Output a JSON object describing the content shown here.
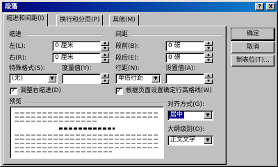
{
  "window": {
    "title": "段落"
  },
  "title_buttons": {
    "help": "?",
    "close": "X"
  },
  "tabs": [
    {
      "label": "缩进和间距(I)"
    },
    {
      "label": "换行和分页(P)"
    },
    {
      "label": "其他(M)"
    }
  ],
  "indent": {
    "section": "缩进",
    "left_label": "左(L):",
    "left_value": "0 厘米",
    "right_label": "右(R):",
    "right_value": "0 厘米",
    "special_label": "特殊格式(S):",
    "special_value": "(无)",
    "measure_label": "度量值(Y):",
    "measure_value": "",
    "mirror_check": "调整右缩进(D)",
    "mirror_checked": true
  },
  "spacing": {
    "section": "间距",
    "before_label": "段前(B):",
    "before_value": "0 磅",
    "after_label": "段后(E):",
    "after_value": "0 磅",
    "line_label": "行距(N):",
    "line_value": "单倍行距",
    "at_label": "设置值(A):",
    "at_value": "",
    "grid_check": "根据页面设置确定行高格线(W)",
    "grid_checked": true
  },
  "preview": {
    "label": "预览"
  },
  "alignment": {
    "label": "对齐方式(G):",
    "value": "居中"
  },
  "outline": {
    "label": "大纲级别(O):",
    "value": "正文文字"
  },
  "buttons": {
    "ok": "确定",
    "cancel": "取消",
    "tabs": "制表位(T)..."
  },
  "icons": {
    "dropdown": "▼",
    "spin_up": "▲",
    "spin_down": "▼",
    "check": "✓"
  },
  "colors": {
    "title_start": "#00007b",
    "title_end": "#1084d0",
    "face": "#c0c0c0",
    "selection": "#000080"
  }
}
